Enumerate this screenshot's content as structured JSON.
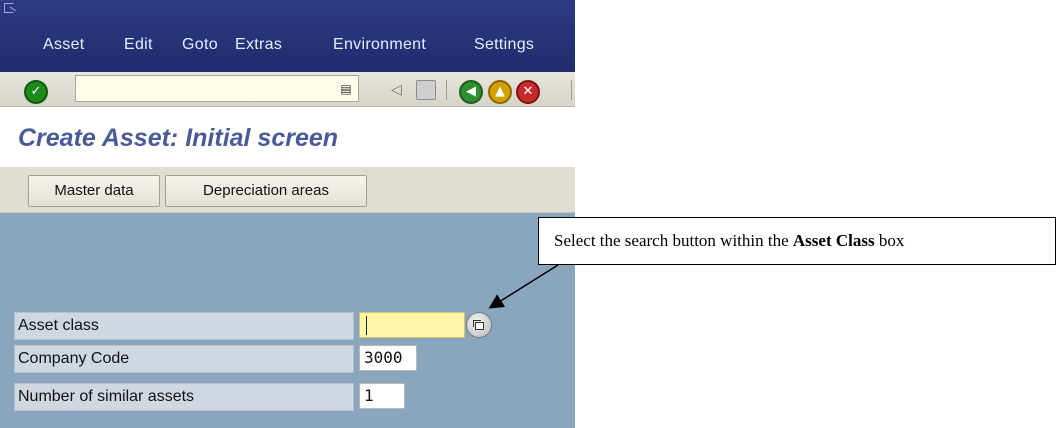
{
  "menu": {
    "items": [
      {
        "label": "Asset"
      },
      {
        "label": "Edit"
      },
      {
        "label": "Goto"
      },
      {
        "label": "Extras"
      },
      {
        "label": "Environment"
      },
      {
        "label": "Settings"
      }
    ]
  },
  "toolbar": {
    "icons": [
      "enter-check-icon",
      "command-field-history-icon",
      "back-arrow-icon",
      "save-icon",
      "back-icon",
      "exit-icon",
      "cancel-icon"
    ],
    "command_value": ""
  },
  "page": {
    "title": "Create Asset:  Initial screen"
  },
  "app_toolbar": {
    "master_data": "Master data",
    "depreciation_areas": "Depreciation areas"
  },
  "form": {
    "asset_class_label": "Asset class",
    "asset_class_value": "",
    "company_code_label": "Company Code",
    "company_code_value": "3000",
    "similar_assets_label": "Number of similar assets",
    "similar_assets_value": "1"
  },
  "callout": {
    "text_before": "Select the search button within the ",
    "bold": "Asset Class",
    "text_after": " box"
  },
  "colors": {
    "menubar": "#2c3b84",
    "title": "#4a5b97",
    "form_background": "#8aa6bf",
    "required_field": "#fff6a8"
  }
}
